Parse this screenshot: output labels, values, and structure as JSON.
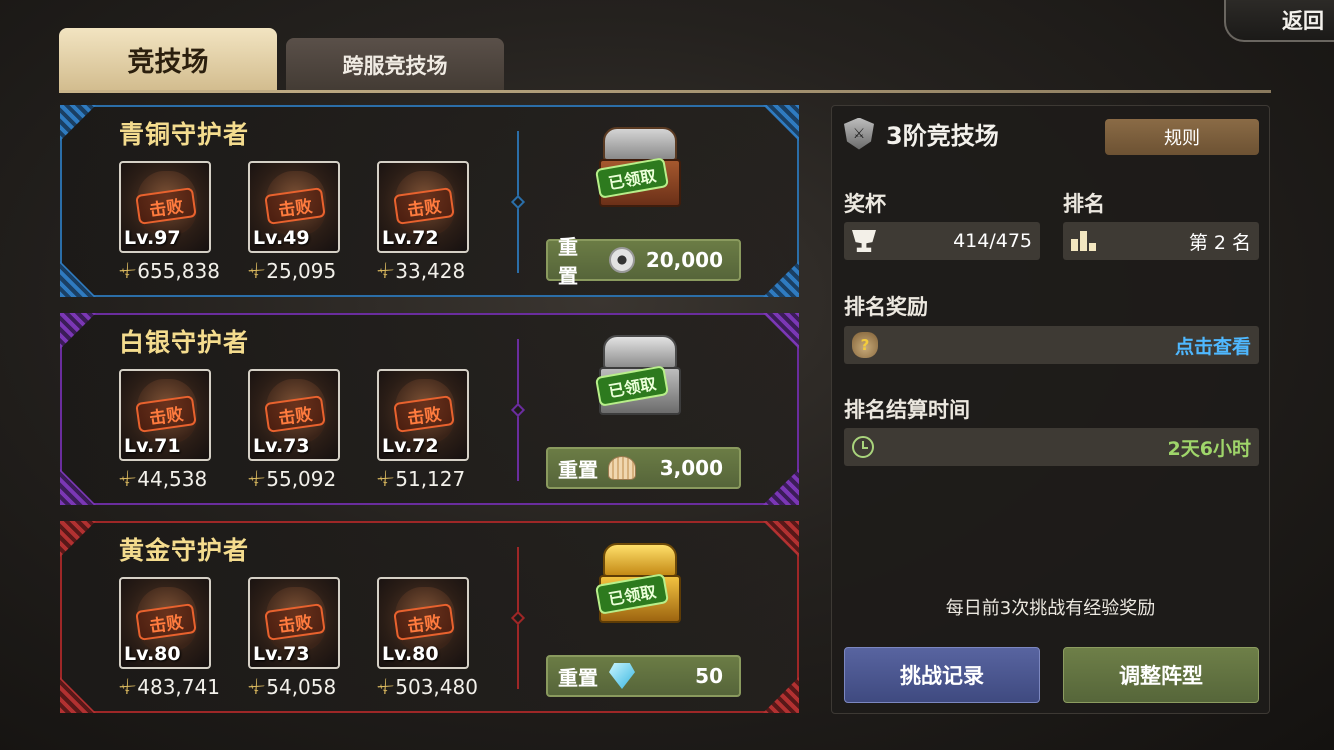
{
  "back_label": "返回",
  "tabs": [
    {
      "label": "竞技场",
      "active": true
    },
    {
      "label": "跨服竞技场",
      "active": false
    }
  ],
  "guardians": [
    {
      "title": "青铜守护者",
      "tier_color": "#2b6ea8",
      "enemies": [
        {
          "status": "击败",
          "level": "Lv.97",
          "power": "655,838"
        },
        {
          "status": "击败",
          "level": "Lv.49",
          "power": "25,095"
        },
        {
          "status": "击败",
          "level": "Lv.72",
          "power": "33,428"
        }
      ],
      "chest_status": "已领取",
      "reset_label": "重置",
      "reset_currency_icon": "coin-icon",
      "reset_cost": "20,000"
    },
    {
      "title": "白银守护者",
      "tier_color": "#6a2d9e",
      "enemies": [
        {
          "status": "击败",
          "level": "Lv.71",
          "power": "44,538"
        },
        {
          "status": "击败",
          "level": "Lv.73",
          "power": "55,092"
        },
        {
          "status": "击败",
          "level": "Lv.72",
          "power": "51,127"
        }
      ],
      "chest_status": "已领取",
      "reset_label": "重置",
      "reset_currency_icon": "shell-icon",
      "reset_cost": "3,000"
    },
    {
      "title": "黄金守护者",
      "tier_color": "#9e2727",
      "enemies": [
        {
          "status": "击败",
          "level": "Lv.80",
          "power": "483,741"
        },
        {
          "status": "击败",
          "level": "Lv.73",
          "power": "54,058"
        },
        {
          "status": "击败",
          "level": "Lv.80",
          "power": "503,480"
        }
      ],
      "chest_status": "已领取",
      "reset_label": "重置",
      "reset_currency_icon": "diamond-icon",
      "reset_cost": "50"
    }
  ],
  "info": {
    "title": "3阶竞技场",
    "rules_label": "规则",
    "trophy_label": "奖杯",
    "trophy_value": "414/475",
    "rank_label": "排名",
    "rank_value": "第 2 名",
    "rank_reward_label": "排名奖励",
    "rank_reward_link": "点击查看",
    "settle_label": "排名结算时间",
    "settle_value": "2天6小时",
    "daily_note": "每日前3次挑战有经验奖励",
    "record_button": "挑战记录",
    "adjust_button": "调整阵型"
  }
}
